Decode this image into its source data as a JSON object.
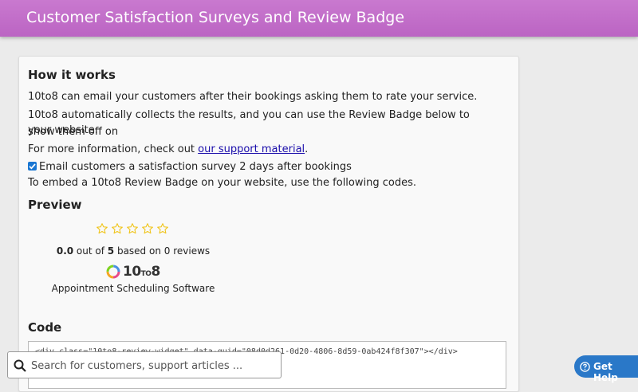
{
  "header": {
    "title": "Customer Satisfaction Surveys and Review Badge"
  },
  "how_it_works": {
    "heading": "How it works",
    "p1": "10to8 can email your customers after their bookings asking them to rate your service.",
    "p2a": "10to8 automatically collects the results, and you can use the Review Badge below to show them off on",
    "p2b": "your website.",
    "p3_prefix": "For more information, check out ",
    "p3_link": "our support material",
    "p3_suffix": ".",
    "checkbox_label": "Email customers a satisfaction survey 2 days after bookings",
    "checkbox_checked": true,
    "embed_text": "To embed a 10to8 Review Badge on your website, use the following codes."
  },
  "preview": {
    "heading": "Preview",
    "star_count": 5,
    "rating_value": "0.0",
    "rating_mid": " out of ",
    "rating_max": "5",
    "rating_suffix": " based on 0 reviews",
    "logo_main": "10",
    "logo_small": "TO",
    "logo_end": "8",
    "tagline": "Appointment Scheduling Software"
  },
  "code": {
    "heading": "Code",
    "snippet": "<div class=\"10to8-review-widget\" data-guid=\"08d0d261-0d20-4806-8d59-0ab424f8f307\"></div>"
  },
  "search": {
    "placeholder": "Search for customers, support articles ..."
  },
  "help": {
    "label": "Get Help"
  },
  "colors": {
    "header": "#c06ec8",
    "link": "#1a0dab",
    "help": "#2a78c8",
    "star": "#f0c419"
  }
}
